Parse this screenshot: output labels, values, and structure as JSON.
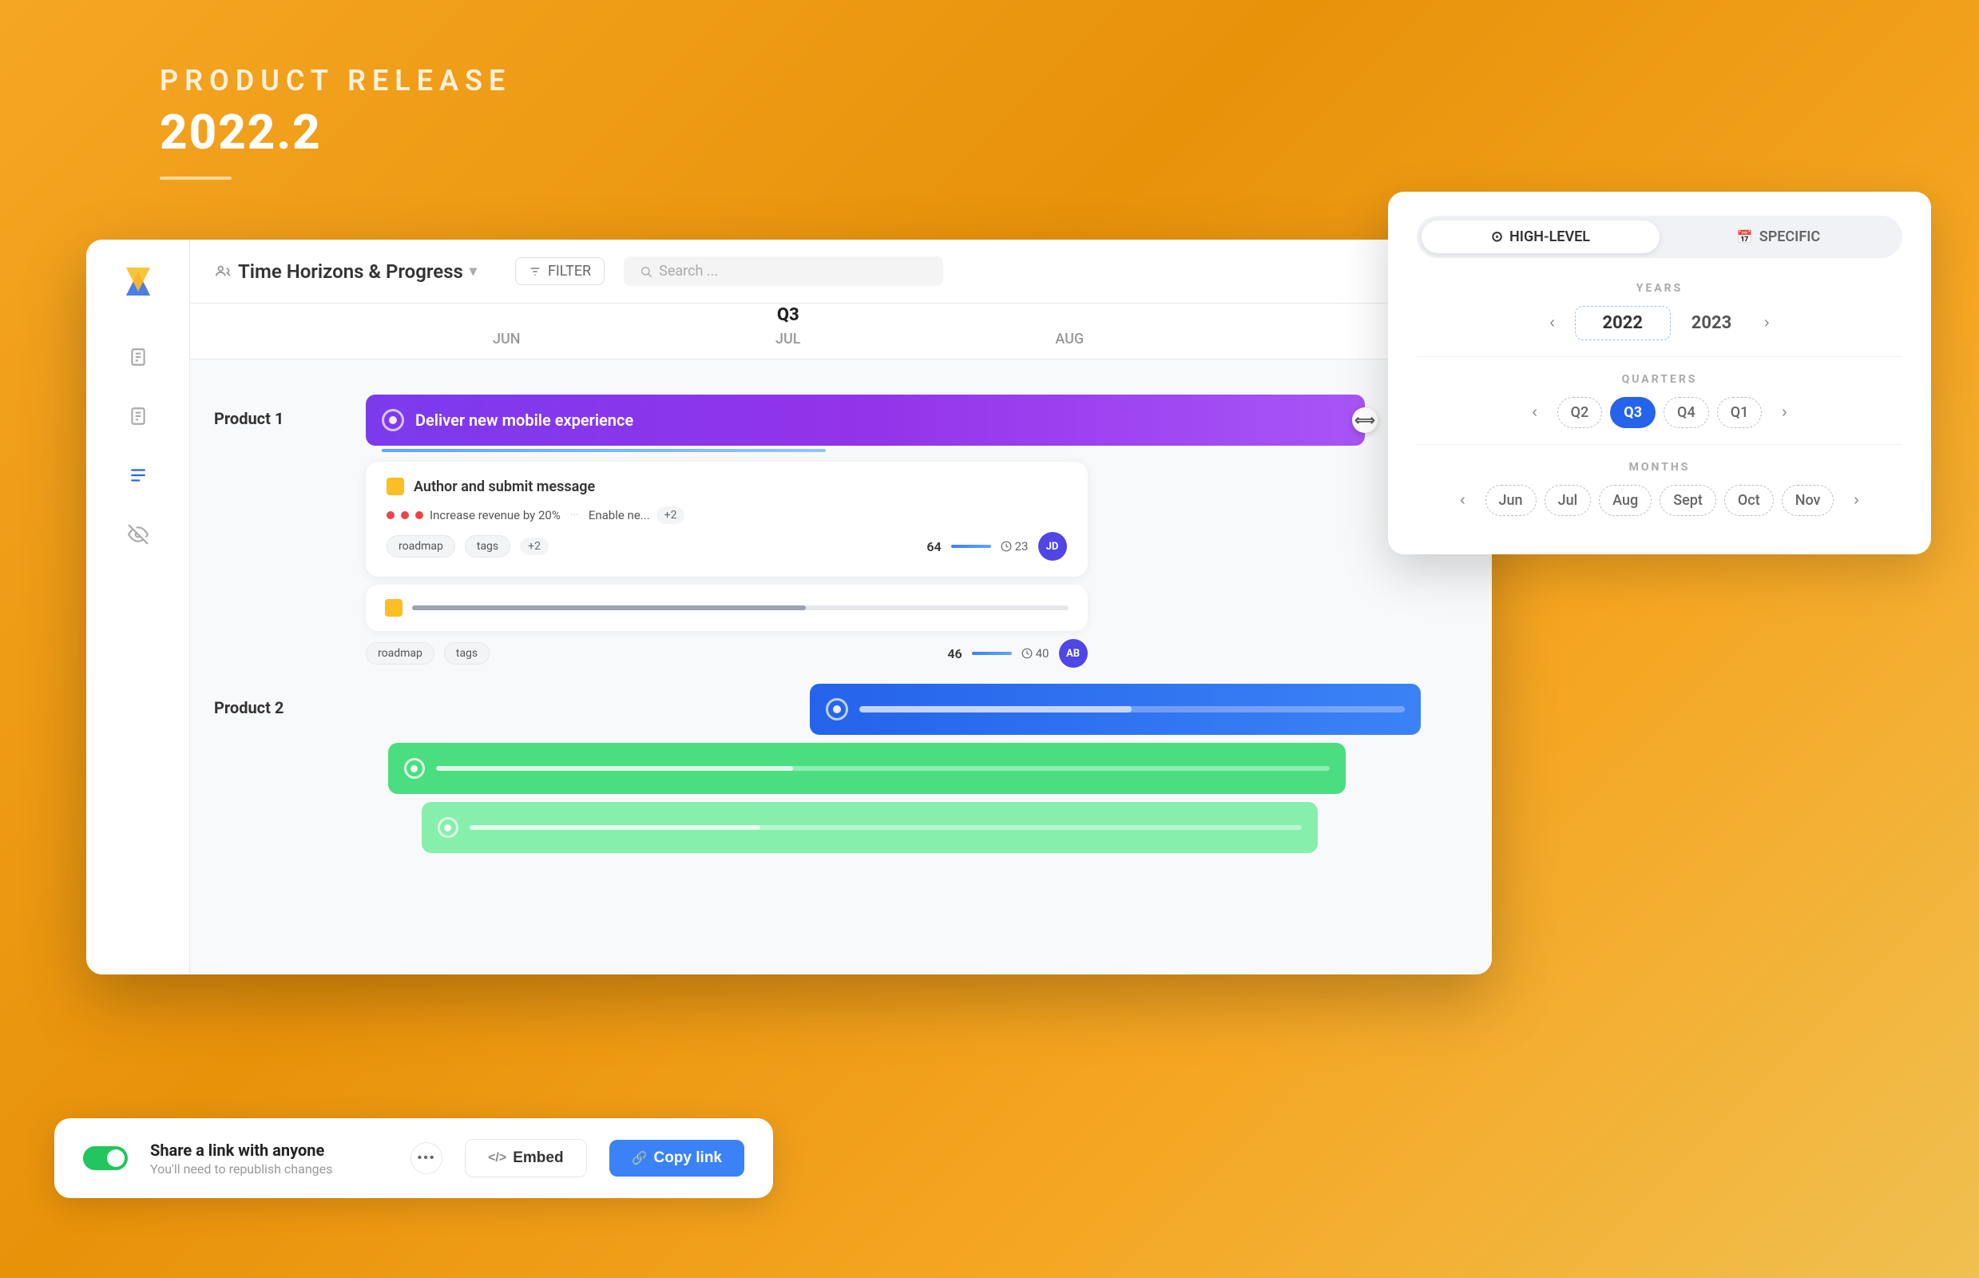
{
  "header": {
    "subtitle": "PRODUCT RELEASE",
    "title": "2022.2"
  },
  "topbar": {
    "title": "Time Horizons & Progress",
    "filter_label": "FILTER",
    "search_placeholder": "Search ...",
    "dropdown_icon": "▾"
  },
  "timeline": {
    "quarter_label": "Q3",
    "months": [
      "JUN",
      "JUL",
      "AUG"
    ]
  },
  "calendar_panel": {
    "tabs": [
      {
        "label": "HIGH-LEVEL",
        "icon": "⊙",
        "active": true
      },
      {
        "label": "SPECIFIC",
        "icon": "📅",
        "active": false
      }
    ],
    "years_label": "YEARS",
    "years": [
      "2022",
      "2023"
    ],
    "quarters_label": "QUARTERS",
    "quarters": [
      "Q2",
      "Q3",
      "Q4",
      "Q1"
    ],
    "active_quarter": "Q3",
    "months_label": "MONTHS",
    "months": [
      "Jun",
      "Jul",
      "Aug",
      "Sept",
      "Oct",
      "Nov"
    ],
    "active_month": null
  },
  "product1": {
    "label": "Product 1",
    "main_bar": {
      "title": "Deliver new mobile experience",
      "color": "purple"
    },
    "expanded_card": {
      "item1_title": "Author and submit message",
      "sub_item1": "Increase revenue by 20%",
      "sub_item2": "Enable ne...",
      "plus_count": "+2",
      "tags": [
        "roadmap",
        "tags"
      ],
      "tag_extra": "+2",
      "num_stat": "64",
      "time_stat": "23"
    },
    "second_bar": {
      "tags": [
        "roadmap",
        "tags"
      ],
      "num_stat": "46",
      "time_stat": "40"
    }
  },
  "product2": {
    "label": "Product 2",
    "bars": [
      "blue",
      "green1",
      "green2"
    ]
  },
  "share_bar": {
    "toggle_on": true,
    "title": "Share a link with anyone",
    "subtitle": "You'll need to republish changes",
    "more_icon": "•••",
    "embed_label": "Embed",
    "copy_link_label": "Copy link",
    "embed_icon": "</>",
    "copy_icon": "🔗"
  },
  "sidebar": {
    "icons": [
      "document",
      "document2",
      "list",
      "eye-slash"
    ]
  },
  "colors": {
    "purple_bar": "#8B2FC9",
    "blue_bar": "#3B82F6",
    "green_bar": "#4ADE80",
    "accent": "#F5A623"
  }
}
